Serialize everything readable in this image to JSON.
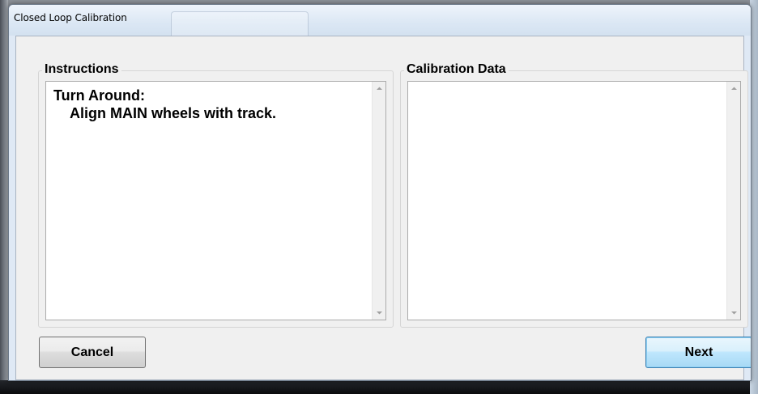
{
  "window": {
    "title": "Closed Loop Calibration"
  },
  "instructions": {
    "label": "Instructions",
    "line1": "Turn Around:",
    "line2": "Align MAIN wheels with track."
  },
  "calibration_data": {
    "label": "Calibration Data",
    "content": ""
  },
  "buttons": {
    "cancel": "Cancel",
    "next": "Next"
  },
  "icons": {
    "scroll_up": "scroll-up-arrow",
    "scroll_down": "scroll-down-arrow"
  }
}
